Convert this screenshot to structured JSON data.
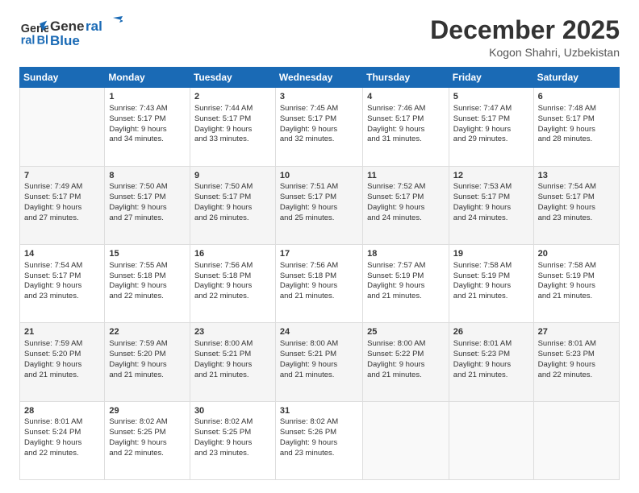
{
  "header": {
    "logo_general": "General",
    "logo_blue": "Blue",
    "month_title": "December 2025",
    "location": "Kogon Shahri, Uzbekistan"
  },
  "days_of_week": [
    "Sunday",
    "Monday",
    "Tuesday",
    "Wednesday",
    "Thursday",
    "Friday",
    "Saturday"
  ],
  "weeks": [
    [
      {
        "day": "",
        "sunrise": "",
        "sunset": "",
        "daylight": ""
      },
      {
        "day": "1",
        "sunrise": "Sunrise: 7:43 AM",
        "sunset": "Sunset: 5:17 PM",
        "daylight": "Daylight: 9 hours and 34 minutes."
      },
      {
        "day": "2",
        "sunrise": "Sunrise: 7:44 AM",
        "sunset": "Sunset: 5:17 PM",
        "daylight": "Daylight: 9 hours and 33 minutes."
      },
      {
        "day": "3",
        "sunrise": "Sunrise: 7:45 AM",
        "sunset": "Sunset: 5:17 PM",
        "daylight": "Daylight: 9 hours and 32 minutes."
      },
      {
        "day": "4",
        "sunrise": "Sunrise: 7:46 AM",
        "sunset": "Sunset: 5:17 PM",
        "daylight": "Daylight: 9 hours and 31 minutes."
      },
      {
        "day": "5",
        "sunrise": "Sunrise: 7:47 AM",
        "sunset": "Sunset: 5:17 PM",
        "daylight": "Daylight: 9 hours and 29 minutes."
      },
      {
        "day": "6",
        "sunrise": "Sunrise: 7:48 AM",
        "sunset": "Sunset: 5:17 PM",
        "daylight": "Daylight: 9 hours and 28 minutes."
      }
    ],
    [
      {
        "day": "7",
        "sunrise": "Sunrise: 7:49 AM",
        "sunset": "Sunset: 5:17 PM",
        "daylight": "Daylight: 9 hours and 27 minutes."
      },
      {
        "day": "8",
        "sunrise": "Sunrise: 7:50 AM",
        "sunset": "Sunset: 5:17 PM",
        "daylight": "Daylight: 9 hours and 27 minutes."
      },
      {
        "day": "9",
        "sunrise": "Sunrise: 7:50 AM",
        "sunset": "Sunset: 5:17 PM",
        "daylight": "Daylight: 9 hours and 26 minutes."
      },
      {
        "day": "10",
        "sunrise": "Sunrise: 7:51 AM",
        "sunset": "Sunset: 5:17 PM",
        "daylight": "Daylight: 9 hours and 25 minutes."
      },
      {
        "day": "11",
        "sunrise": "Sunrise: 7:52 AM",
        "sunset": "Sunset: 5:17 PM",
        "daylight": "Daylight: 9 hours and 24 minutes."
      },
      {
        "day": "12",
        "sunrise": "Sunrise: 7:53 AM",
        "sunset": "Sunset: 5:17 PM",
        "daylight": "Daylight: 9 hours and 24 minutes."
      },
      {
        "day": "13",
        "sunrise": "Sunrise: 7:54 AM",
        "sunset": "Sunset: 5:17 PM",
        "daylight": "Daylight: 9 hours and 23 minutes."
      }
    ],
    [
      {
        "day": "14",
        "sunrise": "Sunrise: 7:54 AM",
        "sunset": "Sunset: 5:17 PM",
        "daylight": "Daylight: 9 hours and 23 minutes."
      },
      {
        "day": "15",
        "sunrise": "Sunrise: 7:55 AM",
        "sunset": "Sunset: 5:18 PM",
        "daylight": "Daylight: 9 hours and 22 minutes."
      },
      {
        "day": "16",
        "sunrise": "Sunrise: 7:56 AM",
        "sunset": "Sunset: 5:18 PM",
        "daylight": "Daylight: 9 hours and 22 minutes."
      },
      {
        "day": "17",
        "sunrise": "Sunrise: 7:56 AM",
        "sunset": "Sunset: 5:18 PM",
        "daylight": "Daylight: 9 hours and 21 minutes."
      },
      {
        "day": "18",
        "sunrise": "Sunrise: 7:57 AM",
        "sunset": "Sunset: 5:19 PM",
        "daylight": "Daylight: 9 hours and 21 minutes."
      },
      {
        "day": "19",
        "sunrise": "Sunrise: 7:58 AM",
        "sunset": "Sunset: 5:19 PM",
        "daylight": "Daylight: 9 hours and 21 minutes."
      },
      {
        "day": "20",
        "sunrise": "Sunrise: 7:58 AM",
        "sunset": "Sunset: 5:19 PM",
        "daylight": "Daylight: 9 hours and 21 minutes."
      }
    ],
    [
      {
        "day": "21",
        "sunrise": "Sunrise: 7:59 AM",
        "sunset": "Sunset: 5:20 PM",
        "daylight": "Daylight: 9 hours and 21 minutes."
      },
      {
        "day": "22",
        "sunrise": "Sunrise: 7:59 AM",
        "sunset": "Sunset: 5:20 PM",
        "daylight": "Daylight: 9 hours and 21 minutes."
      },
      {
        "day": "23",
        "sunrise": "Sunrise: 8:00 AM",
        "sunset": "Sunset: 5:21 PM",
        "daylight": "Daylight: 9 hours and 21 minutes."
      },
      {
        "day": "24",
        "sunrise": "Sunrise: 8:00 AM",
        "sunset": "Sunset: 5:21 PM",
        "daylight": "Daylight: 9 hours and 21 minutes."
      },
      {
        "day": "25",
        "sunrise": "Sunrise: 8:00 AM",
        "sunset": "Sunset: 5:22 PM",
        "daylight": "Daylight: 9 hours and 21 minutes."
      },
      {
        "day": "26",
        "sunrise": "Sunrise: 8:01 AM",
        "sunset": "Sunset: 5:23 PM",
        "daylight": "Daylight: 9 hours and 21 minutes."
      },
      {
        "day": "27",
        "sunrise": "Sunrise: 8:01 AM",
        "sunset": "Sunset: 5:23 PM",
        "daylight": "Daylight: 9 hours and 22 minutes."
      }
    ],
    [
      {
        "day": "28",
        "sunrise": "Sunrise: 8:01 AM",
        "sunset": "Sunset: 5:24 PM",
        "daylight": "Daylight: 9 hours and 22 minutes."
      },
      {
        "day": "29",
        "sunrise": "Sunrise: 8:02 AM",
        "sunset": "Sunset: 5:25 PM",
        "daylight": "Daylight: 9 hours and 22 minutes."
      },
      {
        "day": "30",
        "sunrise": "Sunrise: 8:02 AM",
        "sunset": "Sunset: 5:25 PM",
        "daylight": "Daylight: 9 hours and 23 minutes."
      },
      {
        "day": "31",
        "sunrise": "Sunrise: 8:02 AM",
        "sunset": "Sunset: 5:26 PM",
        "daylight": "Daylight: 9 hours and 23 minutes."
      },
      {
        "day": "",
        "sunrise": "",
        "sunset": "",
        "daylight": ""
      },
      {
        "day": "",
        "sunrise": "",
        "sunset": "",
        "daylight": ""
      },
      {
        "day": "",
        "sunrise": "",
        "sunset": "",
        "daylight": ""
      }
    ]
  ]
}
